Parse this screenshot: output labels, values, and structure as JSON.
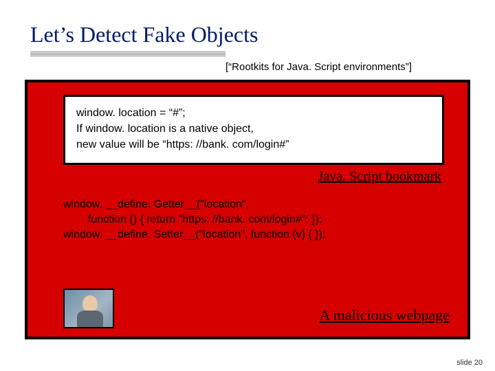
{
  "title": "Let’s Detect Fake Objects",
  "citation": "[“Rootkits for Java. Script environments”]",
  "white_box": {
    "line1": "window. location = “#”;",
    "line2": "If window. location is a native object,",
    "line3": "new value will be “https: //bank. com/login#”"
  },
  "label_bookmark": "Java. Script bookmark",
  "code": {
    "l1": "window. __define. Getter__(\"location\",",
    "l2": "function () { return \"https: //bank. com/login#\"; });",
    "l3": "window. __define. Setter__(\"location\", function (v) { });"
  },
  "label_malicious": "A malicious webpage",
  "slide_num": "slide 20"
}
